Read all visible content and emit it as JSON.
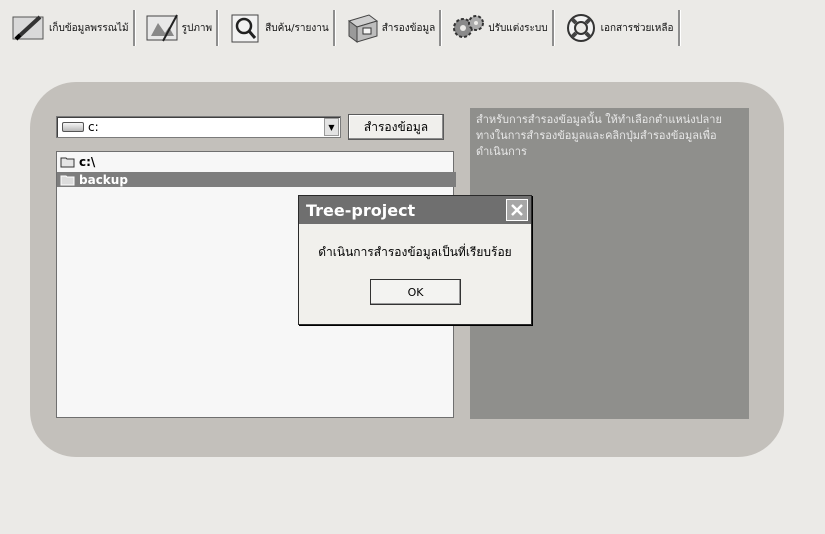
{
  "toolbar": {
    "items": [
      {
        "label": "เก็บข้อมูลพรรณไม้",
        "icon": "pencil-icon"
      },
      {
        "label": "รูปภาพ",
        "icon": "picture-drawing-icon"
      },
      {
        "label": "สืบค้น/รายงาน",
        "icon": "magnifier-document-icon"
      },
      {
        "label": "สำรองข้อมูล",
        "icon": "file-cabinet-icon"
      },
      {
        "label": "ปรับแต่งระบบ",
        "icon": "gears-icon"
      },
      {
        "label": "เอกสารช่วยเหลือ",
        "icon": "lifebuoy-icon"
      }
    ]
  },
  "backup": {
    "drive_value": "c:",
    "backup_button_label": "สำรองข้อมูล",
    "directories": [
      {
        "label": "c:\\",
        "selected": false
      },
      {
        "label": "backup",
        "selected": true
      }
    ],
    "info_text": "สำหรับการสำรองข้อมูลนั้น ให้ทำเลือกตำแหน่งปลายทางในการสำรองข้อมูลและคลิกปุ่มสำรองข้อมูลเพื่อดำเนินการ"
  },
  "dialog": {
    "title": "Tree-project",
    "message": "ดำเนินการสำรองข้อมูลเป็นที่เรียบร้อย",
    "ok_label": "OK"
  },
  "colors": {
    "panel": "#c3c0bb",
    "info_panel": "#8f8f8c",
    "selection": "#7d7d7d",
    "dialog_title": "#6f6f6f"
  }
}
